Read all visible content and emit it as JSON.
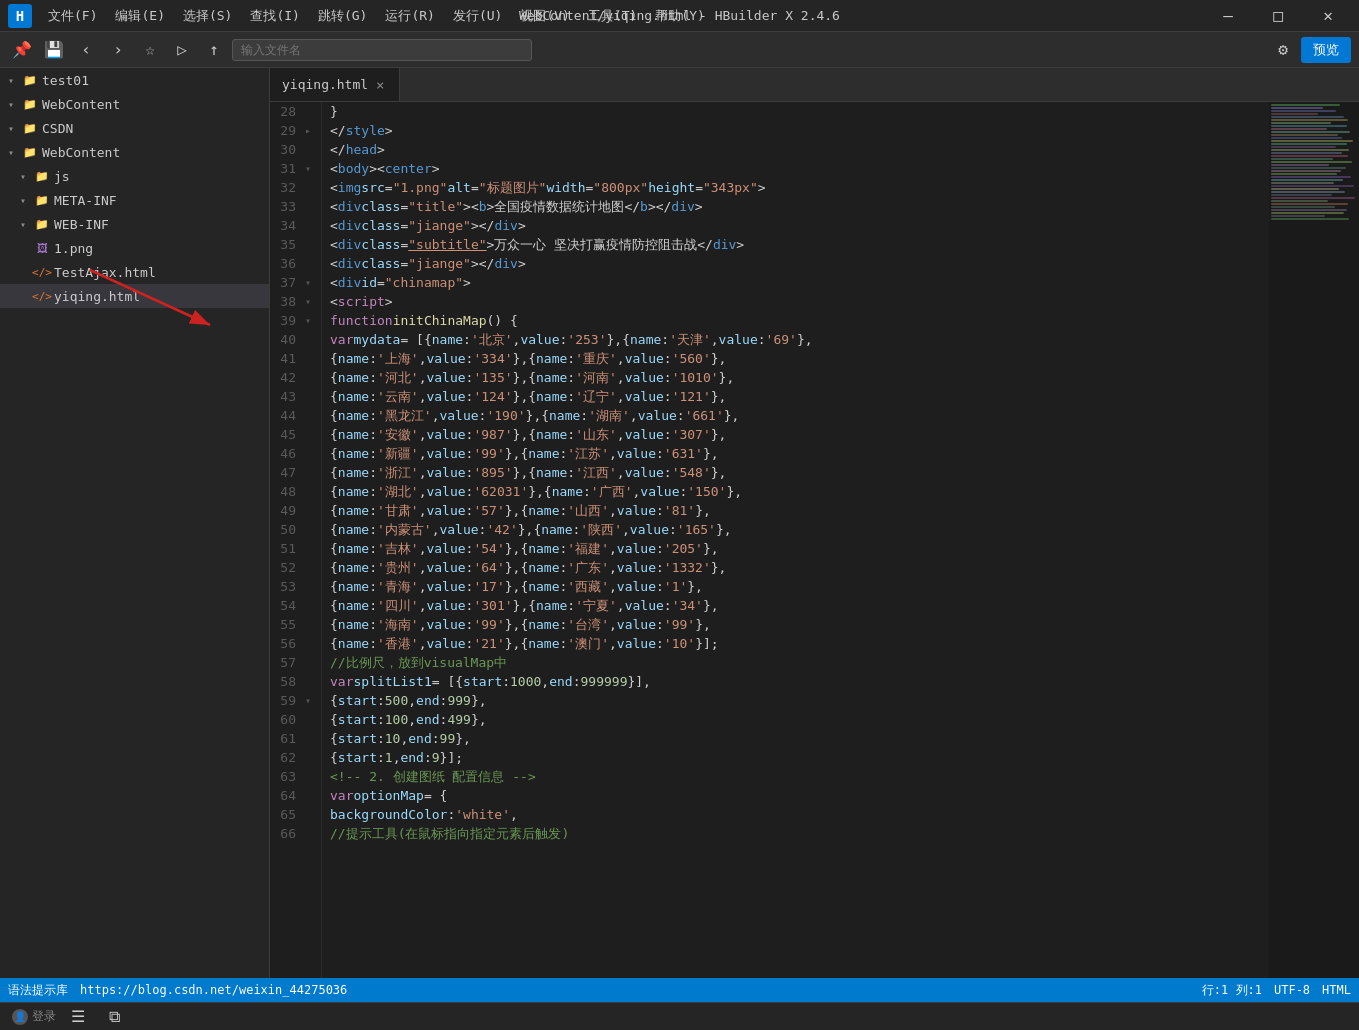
{
  "titleBar": {
    "logo": "H",
    "menus": [
      "文件(F)",
      "编辑(E)",
      "选择(S)",
      "查找(I)",
      "跳转(G)",
      "运行(R)",
      "发行(U)",
      "视图(V)",
      "工具(T)",
      "帮助(Y)"
    ],
    "title": "WebContent/yiqing.html - HBuilder X 2.4.6",
    "minimize": "—",
    "maximize": "□",
    "close": "✕"
  },
  "toolbar": {
    "searchPlaceholder": "输入文件名",
    "previewLabel": "预览",
    "filterIcon": "⚙"
  },
  "sidebar": {
    "items": [
      {
        "indent": 0,
        "type": "folder",
        "collapsed": false,
        "label": "test01"
      },
      {
        "indent": 0,
        "type": "folder",
        "collapsed": false,
        "label": "WebContent"
      },
      {
        "indent": 0,
        "type": "folder",
        "collapsed": false,
        "label": "CSDN"
      },
      {
        "indent": 0,
        "type": "folder",
        "collapsed": false,
        "label": "WebContent"
      },
      {
        "indent": 1,
        "type": "folder",
        "collapsed": false,
        "label": "js"
      },
      {
        "indent": 1,
        "type": "folder",
        "collapsed": false,
        "label": "META-INF"
      },
      {
        "indent": 1,
        "type": "folder",
        "collapsed": false,
        "label": "WEB-INF"
      },
      {
        "indent": 1,
        "type": "png",
        "label": "1.png"
      },
      {
        "indent": 1,
        "type": "html",
        "label": "TestAjax.html"
      },
      {
        "indent": 1,
        "type": "html",
        "label": "yiqing.html",
        "active": true
      }
    ]
  },
  "tabs": [
    {
      "label": "yiqing.html",
      "active": true,
      "closeable": true
    }
  ],
  "codeLines": [
    {
      "num": 28,
      "fold": "",
      "content": "            }"
    },
    {
      "num": 29,
      "fold": "close",
      "content": "        </style>"
    },
    {
      "num": 30,
      "fold": "",
      "content": "    </head>"
    },
    {
      "num": 31,
      "fold": "open",
      "content": "    <body><center>"
    },
    {
      "num": 32,
      "fold": "",
      "content": "        <img src=\"1.png\" alt=\"标题图片\" width=\"800px\" height=\"343px\">"
    },
    {
      "num": 33,
      "fold": "",
      "content": "        <div class=\"title\"><b>全国疫情数据统计地图</b></div>"
    },
    {
      "num": 34,
      "fold": "",
      "content": "        <div class=\"jiange\"></div>"
    },
    {
      "num": 35,
      "fold": "",
      "content": "        <div class=\"subtitle\">万众一心 坚决打赢疫情防控阻击战</div>"
    },
    {
      "num": 36,
      "fold": "",
      "content": "        <div class=\"jiange\"></div>"
    },
    {
      "num": 37,
      "fold": "open",
      "content": "        <div id=\"chinamap\">"
    },
    {
      "num": 38,
      "fold": "open",
      "content": "            <script>"
    },
    {
      "num": 39,
      "fold": "open",
      "content": "                function initChinaMap() {"
    },
    {
      "num": 40,
      "fold": "",
      "content": "                    var mydata = [{name: '北京',value: '253' },{name: '天津',value: '69' },"
    },
    {
      "num": 41,
      "fold": "",
      "content": "                                 {name: '上海',value: '334' },{name: '重庆',value: '560' },"
    },
    {
      "num": 42,
      "fold": "",
      "content": "                                 {name: '河北',value: '135' },{name: '河南',value: '1010' },"
    },
    {
      "num": 43,
      "fold": "",
      "content": "                                 {name: '云南',value: '124' },{name: '辽宁',value: '121' },"
    },
    {
      "num": 44,
      "fold": "",
      "content": "                                 {name: '黑龙江',value: '190' },{name: '湖南',value: '661' },"
    },
    {
      "num": 45,
      "fold": "",
      "content": "                                 {name: '安徽',value: '987' },{name: '山东',value: '307' },"
    },
    {
      "num": 46,
      "fold": "",
      "content": "                                 {name: '新疆',value: '99' },{name: '江苏',value: '631' },"
    },
    {
      "num": 47,
      "fold": "",
      "content": "                                 {name: '浙江',value: '895' },{name: '江西',value: '548' },"
    },
    {
      "num": 48,
      "fold": "",
      "content": "                                 {name: '湖北',value: '62031' },{name: '广西',value: '150' },"
    },
    {
      "num": 49,
      "fold": "",
      "content": "                                 {name: '甘肃',value: '57' },{name: '山西',value: '81' },"
    },
    {
      "num": 50,
      "fold": "",
      "content": "                                 {name: '内蒙古',value: '42' },{name: '陕西',value: '165' },"
    },
    {
      "num": 51,
      "fold": "",
      "content": "                                 {name: '吉林',value: '54' },{name: '福建',value: '205' },"
    },
    {
      "num": 52,
      "fold": "",
      "content": "                                 {name: '贵州',value: '64' },{name: '广东',value: '1332' },"
    },
    {
      "num": 53,
      "fold": "",
      "content": "                                 {name: '青海',value: '17' },{name: '西藏',value: '1' },"
    },
    {
      "num": 54,
      "fold": "",
      "content": "                                 {name: '四川',value: '301' },{name: '宁夏',value: '34' },"
    },
    {
      "num": 55,
      "fold": "",
      "content": "                                 {name: '海南',value: '99' },{name: '台湾',value: '99' },"
    },
    {
      "num": 56,
      "fold": "",
      "content": "                                 {name: '香港',value: '21' },{name: '澳门',value: '10' }];"
    },
    {
      "num": 57,
      "fold": "",
      "content": "                    //比例尺，放到visualMap中"
    },
    {
      "num": 58,
      "fold": "",
      "content": "                    var splitList1 = [{start:1000,end:999999},"
    },
    {
      "num": 59,
      "fold": "",
      "content": "                                      {start:500,end:999},"
    },
    {
      "num": 60,
      "fold": "",
      "content": "                                      {start:100,end:499},"
    },
    {
      "num": 61,
      "fold": "",
      "content": "                                      {start:10,end:99},"
    },
    {
      "num": 62,
      "fold": "",
      "content": "                                      {start:1,end:9}];"
    },
    {
      "num": 63,
      "fold": "",
      "content": "                    <!-- 2. 创建图纸 配置信息 -->"
    },
    {
      "num": 64,
      "fold": "open",
      "content": "                    var optionMap = {"
    },
    {
      "num": 65,
      "fold": "",
      "content": "                        backgroundColor: 'white',"
    },
    {
      "num": 66,
      "fold": "",
      "content": "                        //提示工具(在鼠标指向指定元素后触发)"
    }
  ],
  "statusBar": {
    "left": {
      "login": "登录",
      "icon1": "☰",
      "icon2": "⧉"
    },
    "right": {
      "position": "行:1  列:1",
      "encoding": "UTF-8",
      "syntax": "HTML",
      "tip": "语法提示库",
      "link": "https://blog.csdn.net/weixin_44275036"
    }
  }
}
